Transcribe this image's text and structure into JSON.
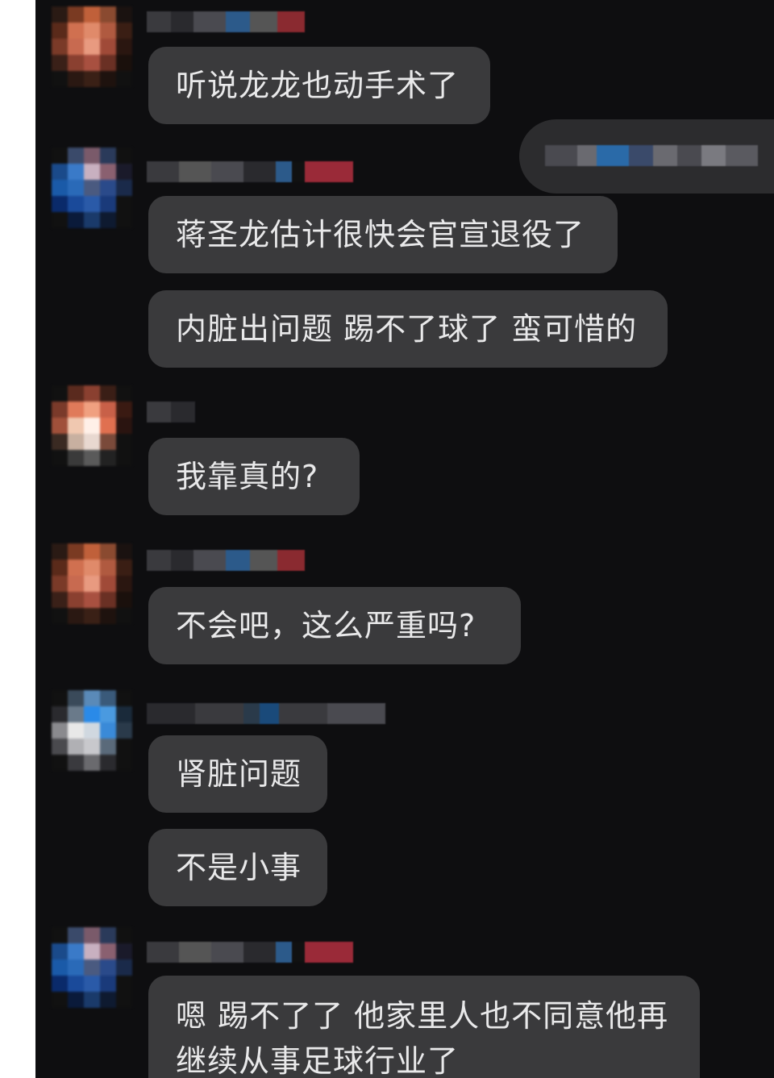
{
  "chat": {
    "messages": [
      {
        "text": "听说龙龙也动手术了"
      },
      {
        "text": "蒋圣龙估计很快会官宣退役了"
      },
      {
        "text": "内脏出问题 踢不了球了 蛮可惜的"
      },
      {
        "text": "我靠真的?"
      },
      {
        "text": "不会吧，这么严重吗?"
      },
      {
        "text": "肾脏问题"
      },
      {
        "text": "不是小事"
      },
      {
        "text": "嗯 踢不了了 他家里人也不同意他再继续从事足球行业了"
      }
    ]
  },
  "colors": {
    "background": "#0e0e10",
    "bubble": "#3a3a3c",
    "text": "#e9e9ea"
  }
}
